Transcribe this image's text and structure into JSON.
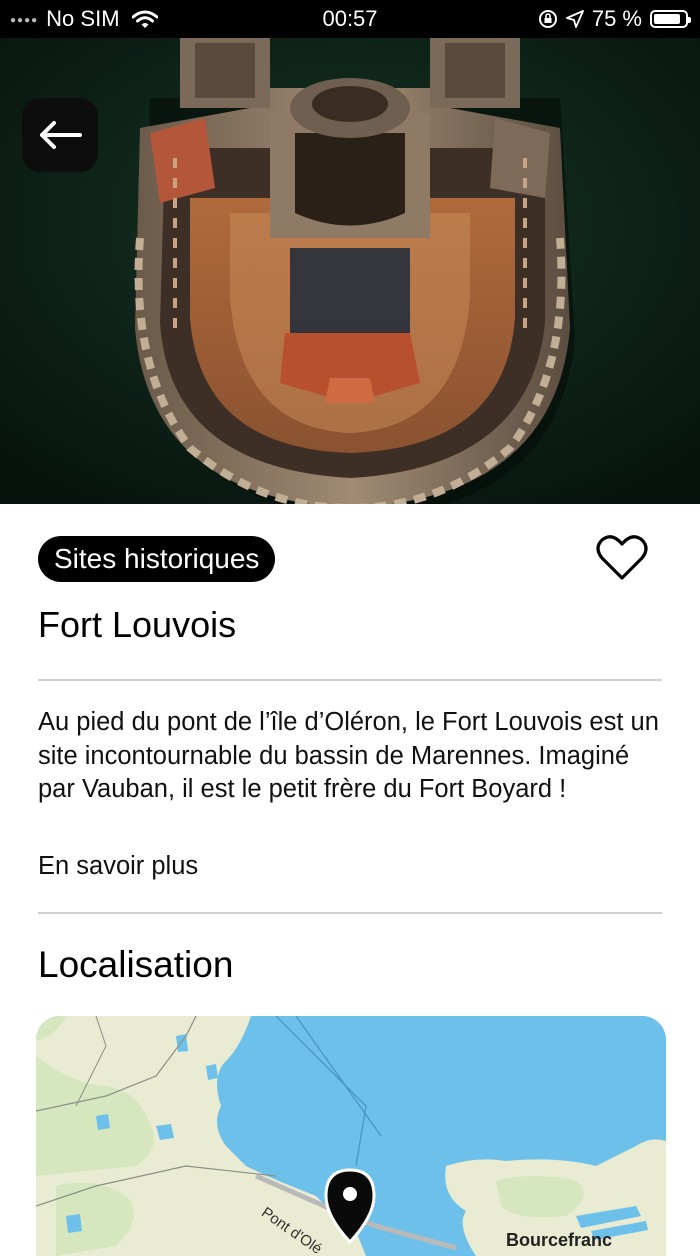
{
  "status_bar": {
    "carrier": "No SIM",
    "time": "00:57",
    "battery": "75 %"
  },
  "hero": {
    "back_icon": "arrow-left-icon",
    "page_indicator": {
      "count": 1,
      "active": 1
    }
  },
  "detail": {
    "category": "Sites historiques",
    "favorite_icon": "heart-outline-icon",
    "title": "Fort Louvois",
    "description": "Au pied du pont de l’île d’Oléron, le Fort Louvois est un site incontournable du bassin de Marennes. Imaginé par Vauban, il est le petit frère du Fort Boyard !",
    "more_link": "En savoir plus"
  },
  "location": {
    "heading": "Localisation",
    "map_road_label": "Pont d'Olé",
    "map_town_label": "Bourcefranc",
    "pin_icon": "map-pin-icon"
  },
  "colors": {
    "accent": "#000000",
    "water": "#6dc0ea",
    "land": "#e9ecd2",
    "divider": "#cfcfcf"
  }
}
